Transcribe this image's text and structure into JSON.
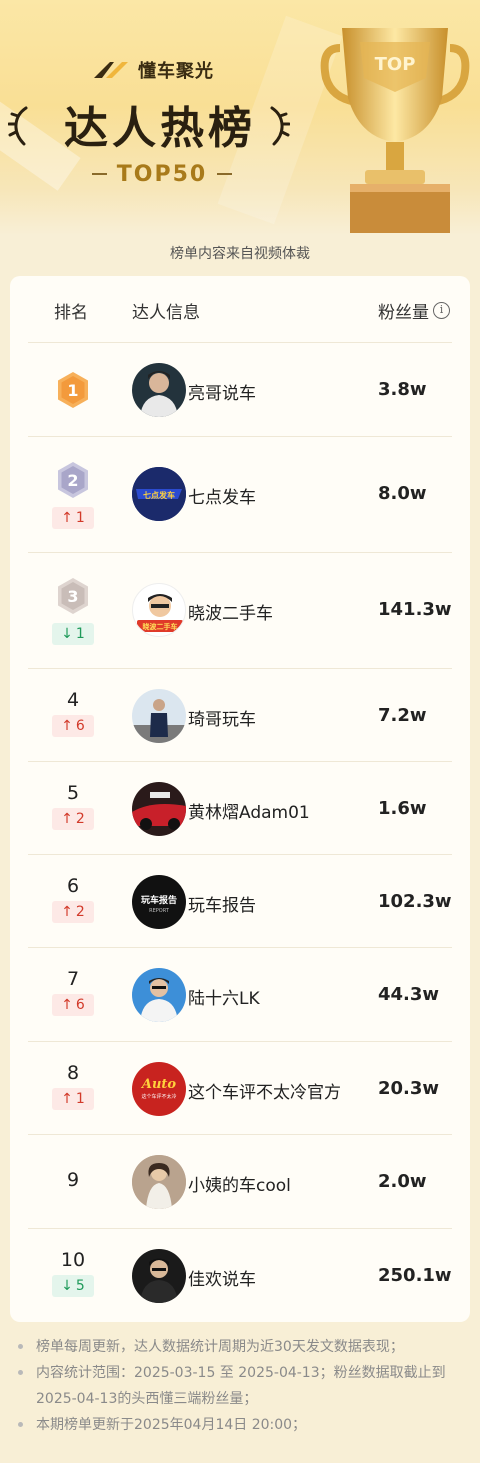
{
  "brand": {
    "name": "懂车聚光"
  },
  "hero": {
    "title": "达人热榜",
    "badge": "TOP50",
    "trophy_text": "TOP"
  },
  "subtitle": "榜单内容来自视频体裁",
  "table": {
    "headers": {
      "rank": "排名",
      "info": "达人信息",
      "fans": "粉丝量"
    },
    "rows": [
      {
        "rank": "1",
        "name": "亮哥说车",
        "fans": "3.8w",
        "trend": "",
        "trend_dir": "",
        "medal": "gold"
      },
      {
        "rank": "2",
        "name": "七点发车",
        "fans": "8.0w",
        "trend": "1",
        "trend_dir": "up",
        "medal": "silver"
      },
      {
        "rank": "3",
        "name": "晓波二手车",
        "fans": "141.3w",
        "trend": "1",
        "trend_dir": "down",
        "medal": "bronze"
      },
      {
        "rank": "4",
        "name": "琦哥玩车",
        "fans": "7.2w",
        "trend": "6",
        "trend_dir": "up",
        "medal": ""
      },
      {
        "rank": "5",
        "name": "黄林熠Adam01",
        "fans": "1.6w",
        "trend": "2",
        "trend_dir": "up",
        "medal": ""
      },
      {
        "rank": "6",
        "name": "玩车报告",
        "fans": "102.3w",
        "trend": "2",
        "trend_dir": "up",
        "medal": ""
      },
      {
        "rank": "7",
        "name": "陆十六LK",
        "fans": "44.3w",
        "trend": "6",
        "trend_dir": "up",
        "medal": ""
      },
      {
        "rank": "8",
        "name": "这个车评不太冷官方",
        "fans": "20.3w",
        "trend": "1",
        "trend_dir": "up",
        "medal": ""
      },
      {
        "rank": "9",
        "name": "小姨的车cool",
        "fans": "2.0w",
        "trend": "",
        "trend_dir": "",
        "medal": ""
      },
      {
        "rank": "10",
        "name": "佳欢说车",
        "fans": "250.1w",
        "trend": "5",
        "trend_dir": "down",
        "medal": ""
      }
    ]
  },
  "avatars": {
    "a2_text": "七点发车",
    "a3_text": "晓波二手车",
    "a6_text": "玩车报告",
    "a6_sub": "REPORT",
    "a8_text": "Auto",
    "a8_sub": "这个车评不太冷"
  },
  "notes": [
    "榜单每周更新，达人数据统计周期为近30天发文数据表现；",
    "内容统计范围：2025-03-15 至 2025-04-13；粉丝数据取截止到2025-04-13的头西懂三端粉丝量；",
    "本期榜单更新于2025年04月14日 20:00；"
  ],
  "colors": {
    "up": "#d23a2a",
    "down": "#1f9a5a",
    "gold": "#f5a346",
    "silver": "#a9a6c9",
    "bronze": "#c9bdb8"
  },
  "icons": {
    "info": "info-icon",
    "up": "arrow-up-icon",
    "down": "arrow-down-icon"
  }
}
